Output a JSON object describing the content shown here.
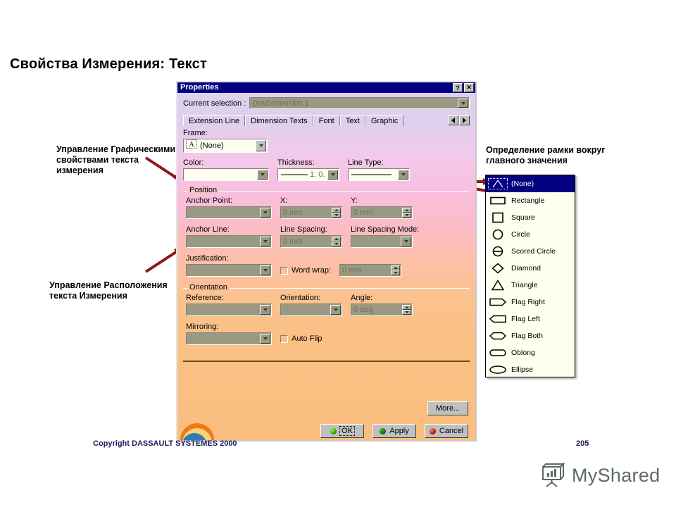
{
  "slide": {
    "title": "Свойства Измерения: Текст",
    "copyright": "Copyright DASSAULT SYSTEMES 2000",
    "page_number": "205"
  },
  "annotations": {
    "left_top": "Управление Графическими свойствами текста измерения",
    "left_bottom": "Управление Расположения текста Измерения",
    "right": "Определение рамки вокруг главного значения"
  },
  "dialog": {
    "title": "Properties",
    "help_button": "?",
    "close_button": "✕",
    "current_selection_label": "Current selection :",
    "current_selection_value": "DrwDimension.1",
    "tabs": [
      {
        "label": "Extension Line",
        "selected": false
      },
      {
        "label": "Dimension Texts",
        "selected": false
      },
      {
        "label": "Font",
        "selected": false
      },
      {
        "label": "Text",
        "selected": true
      },
      {
        "label": "Graphic",
        "selected": false
      }
    ],
    "tab_scroll_prev": "◀",
    "tab_scroll_next": "▶",
    "frame": {
      "label": "Frame:",
      "value": "(None)",
      "icon": "frame-none-icon"
    },
    "graphic_row": [
      {
        "label": "Color:",
        "value": "",
        "kind": "color-combo"
      },
      {
        "label": "Thickness:",
        "value": "1: 0.",
        "kind": "line-combo"
      },
      {
        "label": "Line Type:",
        "value": "",
        "kind": "line-combo"
      }
    ],
    "position_group": {
      "title": "Position",
      "anchor_point": {
        "label": "Anchor Point:",
        "value": ""
      },
      "x": {
        "label": "X:",
        "value": "0 mm"
      },
      "y": {
        "label": "Y:",
        "value": "0 mm"
      },
      "anchor_line": {
        "label": "Anchor Line:",
        "value": ""
      },
      "line_spacing": {
        "label": "Line Spacing:",
        "value": "0 mm"
      },
      "line_spacing_mode": {
        "label": "Line Spacing Mode:",
        "value": ""
      },
      "justification": {
        "label": "Justification:",
        "value": ""
      },
      "word_wrap": {
        "label": "Word wrap:",
        "checked": false,
        "value": "0 mm"
      }
    },
    "orientation_group": {
      "title": "Orientation",
      "reference": {
        "label": "Reference:",
        "value": ""
      },
      "orientation": {
        "label": "Orientation:",
        "value": ""
      },
      "angle": {
        "label": "Angle:",
        "value": "0 deg"
      },
      "mirroring": {
        "label": "Mirroring:",
        "value": ""
      },
      "auto_flip": {
        "label": "Auto Flip",
        "checked": false
      }
    },
    "buttons": {
      "more": "More...",
      "ok": "OK",
      "apply": "Apply",
      "cancel": "Cancel"
    }
  },
  "frame_dropdown": {
    "items": [
      {
        "label": "(None)",
        "icon": "frame-none-icon",
        "selected": true
      },
      {
        "label": "Rectangle",
        "icon": "frame-rectangle-icon",
        "selected": false
      },
      {
        "label": "Square",
        "icon": "frame-square-icon",
        "selected": false
      },
      {
        "label": "Circle",
        "icon": "frame-circle-icon",
        "selected": false
      },
      {
        "label": "Scored Circle",
        "icon": "frame-scored-circle-icon",
        "selected": false
      },
      {
        "label": "Diamond",
        "icon": "frame-diamond-icon",
        "selected": false
      },
      {
        "label": "Triangle",
        "icon": "frame-triangle-icon",
        "selected": false
      },
      {
        "label": "Flag Right",
        "icon": "frame-flag-right-icon",
        "selected": false
      },
      {
        "label": "Flag Left",
        "icon": "frame-flag-left-icon",
        "selected": false
      },
      {
        "label": "Flag Both",
        "icon": "frame-flag-both-icon",
        "selected": false
      },
      {
        "label": "Oblong",
        "icon": "frame-oblong-icon",
        "selected": false
      },
      {
        "label": "Ellipse",
        "icon": "frame-ellipse-icon",
        "selected": false
      }
    ]
  },
  "watermark": {
    "text": "MyShared",
    "icon": "presentation-board-icon"
  },
  "colors": {
    "titlebar": "#000080",
    "dialog_top": "#ddd0ee",
    "dialog_bottom": "#fabf7e",
    "arrow": "#8b1a1a",
    "footer_text": "#1a1a5e"
  }
}
